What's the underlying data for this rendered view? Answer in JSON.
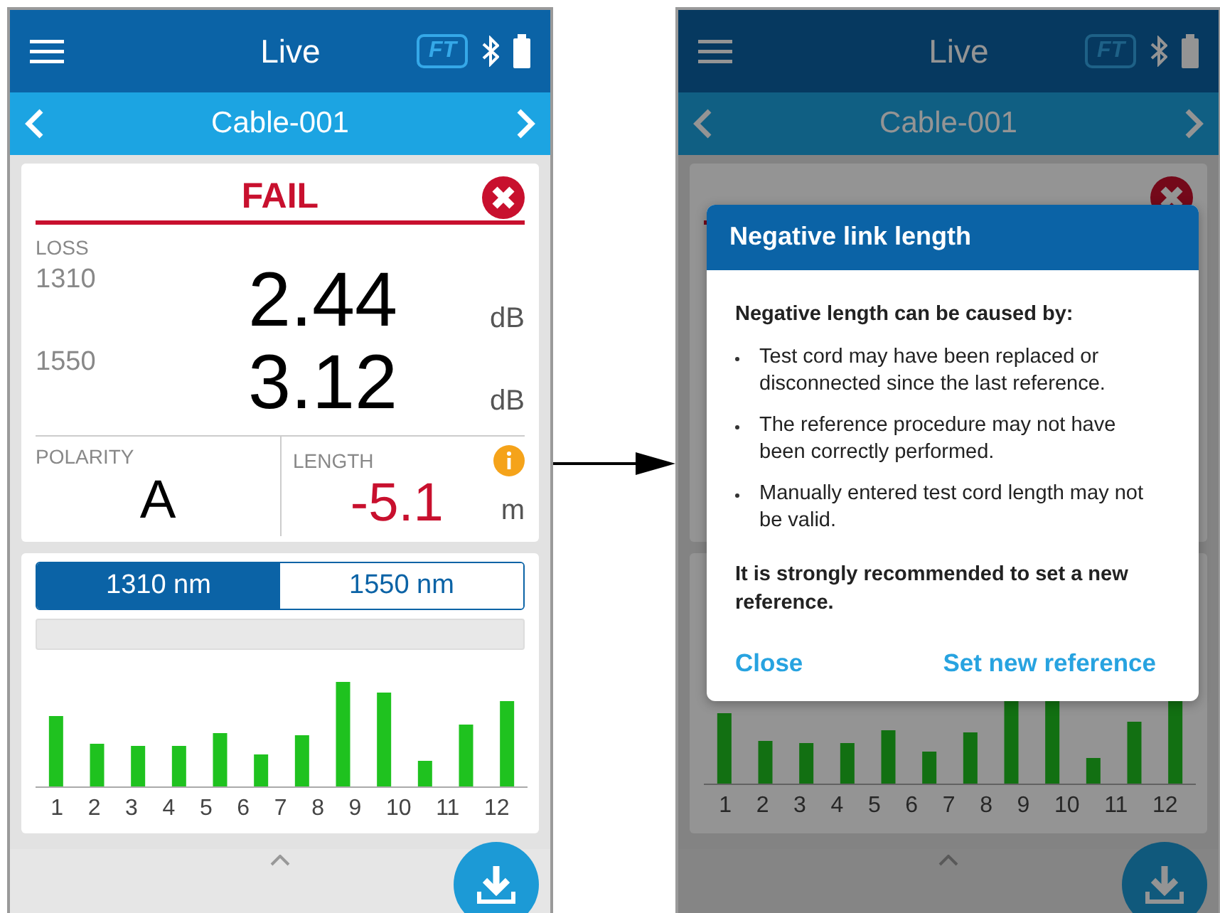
{
  "screens": [
    {
      "dimmed": false,
      "header": {
        "title": "Live",
        "badge": "FT"
      },
      "nav": {
        "title": "Cable-001"
      },
      "result": {
        "status": "FAIL",
        "passed": false
      },
      "loss": {
        "label": "LOSS",
        "rows": [
          {
            "wavelength": "1310",
            "value": "2.44",
            "unit": "dB"
          },
          {
            "wavelength": "1550",
            "value": "3.12",
            "unit": "dB"
          }
        ]
      },
      "polarity": {
        "label": "POLARITY",
        "value": "A"
      },
      "length": {
        "label": "LENGTH",
        "value": "-5.1",
        "unit": "m",
        "failed": true,
        "warning": true
      },
      "tabs": [
        {
          "label": "1310 nm",
          "selected": true
        },
        {
          "label": "1550 nm",
          "selected": false
        }
      ],
      "fibers": [
        "1",
        "2",
        "3",
        "4",
        "5",
        "6",
        "7",
        "8",
        "9",
        "10",
        "11",
        "12"
      ]
    },
    {
      "dimmed": true,
      "header": {
        "title": "Live",
        "badge": "FT"
      },
      "nav": {
        "title": "Cable-001"
      },
      "result": {
        "passed": false
      },
      "fibers": [
        "1",
        "2",
        "3",
        "4",
        "5",
        "6",
        "7",
        "8",
        "9",
        "10",
        "11",
        "12"
      ],
      "dialog": {
        "title": "Negative link length",
        "intro": "Negative length can be caused by:",
        "bullets": [
          "Test cord may have been replaced or disconnected since the last reference.",
          "The reference procedure may not have been correctly performed.",
          "Manually entered test cord length may not be valid."
        ],
        "closing": "It is strongly recommended to set a new reference.",
        "actions": [
          "Close",
          "Set new reference"
        ]
      }
    }
  ]
}
